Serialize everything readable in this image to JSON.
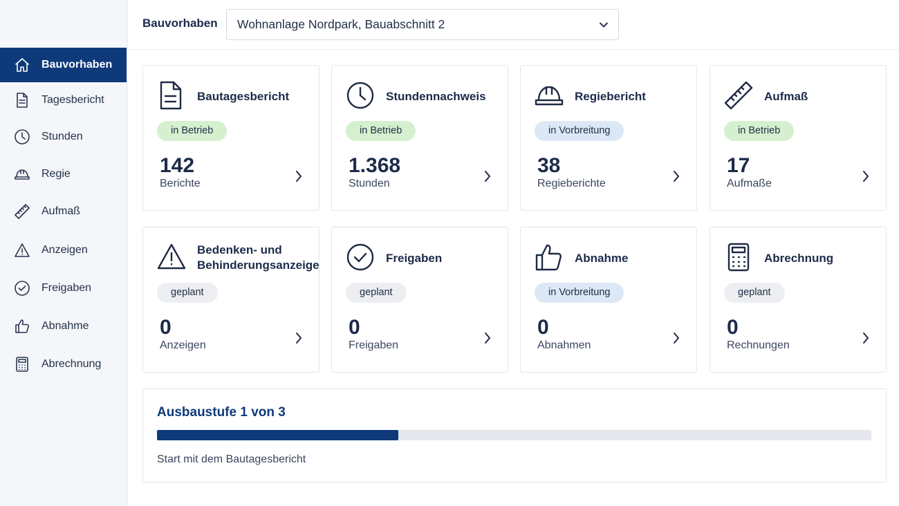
{
  "colors": {
    "accent": "#0e3a7a",
    "badge_betrieb": "#d5f0cf",
    "badge_vorbereitung": "#dce8f6",
    "badge_geplant": "#eceef1"
  },
  "sidebar": {
    "items": [
      {
        "label": "Bauvorhaben",
        "icon": "home-icon",
        "active": true
      },
      {
        "label": "Tagesbericht",
        "icon": "document-icon"
      },
      {
        "label": "Stunden",
        "icon": "clock-icon"
      },
      {
        "label": "Regie",
        "icon": "hardhat-icon"
      },
      {
        "label": "Aufmaß",
        "icon": "ruler-icon"
      },
      {
        "label": "Anzeigen",
        "icon": "warning-icon"
      },
      {
        "label": "Freigaben",
        "icon": "check-circle-icon"
      },
      {
        "label": "Abnahme",
        "icon": "thumbs-up-icon"
      },
      {
        "label": "Abrechnung",
        "icon": "calculator-icon"
      }
    ]
  },
  "header": {
    "project_label": "Bauvorhaben",
    "project_select": {
      "value": "Wohnanlage Nordpark, Bauabschnitt 2"
    }
  },
  "cards": [
    {
      "title": "Bautagesbericht",
      "icon": "document-icon",
      "status": "in Betrieb",
      "count": "142",
      "unit": "Berichte"
    },
    {
      "title": "Stundennachweis",
      "icon": "clock-icon",
      "status": "in Betrieb",
      "count": "1.368",
      "unit": "Stunden"
    },
    {
      "title": "Regiebericht",
      "icon": "hardhat-icon",
      "status": "in Vorbreitung",
      "count": "38",
      "unit": "Regieberichte"
    },
    {
      "title": "Aufmaß",
      "icon": "ruler-icon",
      "status": "in Betrieb",
      "count": "17",
      "unit": "Aufmaße"
    },
    {
      "title": "Bedenken- und Behinderungsanzeige",
      "icon": "warning-icon",
      "status": "geplant",
      "count": "0",
      "unit": "Anzeigen"
    },
    {
      "title": "Freigaben",
      "icon": "check-circle-icon",
      "status": "geplant",
      "count": "0",
      "unit": "Freigaben"
    },
    {
      "title": "Abnahme",
      "icon": "thumbs-up-icon",
      "status": "in Vorbreitung",
      "count": "0",
      "unit": "Abnahmen"
    },
    {
      "title": "Abrechnung",
      "icon": "calculator-icon",
      "status": "geplant",
      "count": "0",
      "unit": "Rechnungen"
    }
  ],
  "progress": {
    "title": "Ausbaustufe 1 von 3",
    "fraction": 0.338,
    "hint": "Start mit dem Bautagesbericht"
  }
}
